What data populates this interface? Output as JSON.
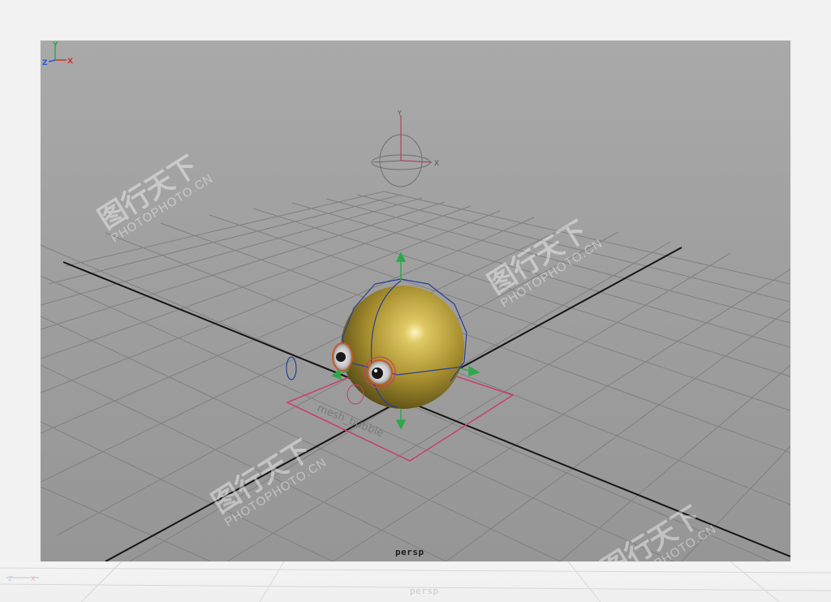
{
  "viewport": {
    "camera_label": "persp",
    "reflection_label": "persp"
  },
  "axes": {
    "y": "Y",
    "x": "X",
    "z": "Z",
    "gizmo_y": "Y",
    "gizmo_x": "X"
  },
  "scene": {
    "object_label": "mesh_bubble",
    "sphere_color": "#c2a93c",
    "grid_color": "#7c7c7c",
    "axis_line_color": "#111111",
    "selection_color": "#c8406a",
    "manipulator_color": "#2ea84a",
    "wire_color": "#2a3f95"
  },
  "watermarks": [
    {
      "cn": "图行天下",
      "en": "PHOTOPHOTO.CN"
    },
    {
      "cn": "图行天下",
      "en": "PHOTOPHOTO.CN"
    },
    {
      "cn": "图行天下",
      "en": "PHOTOPHOTO.CN"
    },
    {
      "cn": "图行天下",
      "en": "PHOTOPHOTO.CN"
    }
  ]
}
